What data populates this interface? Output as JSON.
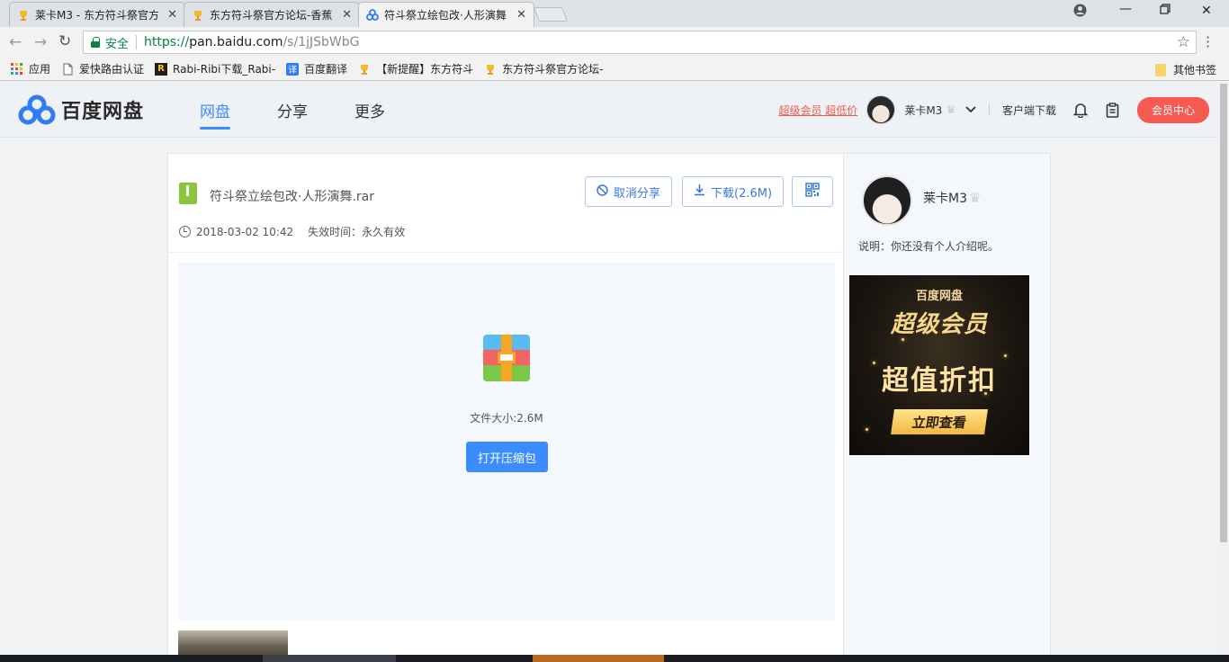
{
  "browser": {
    "tabs": [
      {
        "title": "莱卡M3 - 东方符斗祭官方",
        "active": false
      },
      {
        "title": "东方符斗祭官方论坛-香蕉",
        "active": false
      },
      {
        "title": "符斗祭立绘包改·人形演舞",
        "active": true
      }
    ],
    "address": {
      "secure_label": "安全",
      "scheme": "https://",
      "host": "pan.baidu.com",
      "path": "/s/1jJSbWbG"
    },
    "bookmarks": [
      {
        "label": "应用",
        "icon": "apps-grid-icon"
      },
      {
        "label": "爱快路由认证",
        "icon": "page-icon"
      },
      {
        "label": "Rabi-Ribi下载_Rabi-",
        "icon": "rabi-icon"
      },
      {
        "label": "百度翻译",
        "icon": "translate-icon"
      },
      {
        "label": "【新提醒】东方符斗",
        "icon": "trophy-icon"
      },
      {
        "label": "东方符斗祭官方论坛-",
        "icon": "trophy-icon"
      }
    ],
    "other_bookmarks": "其他书签"
  },
  "header": {
    "logo_text": "百度网盘",
    "nav": [
      {
        "label": "网盘",
        "active": true
      },
      {
        "label": "分享",
        "active": false
      },
      {
        "label": "更多",
        "active": false
      }
    ],
    "svip_link": "超级会员 超低价",
    "username": "莱卡M3",
    "client_download": "客户端下载",
    "vip_center": "会员中心"
  },
  "file": {
    "name": "符斗祭立绘包改·人形演舞.rar",
    "cancel_share": "取消分享",
    "download": "下载(2.6M)",
    "date": "2018-03-02 10:42",
    "expire_label": "失效时间：",
    "expire_value": "永久有效",
    "size_text": "文件大小:2.6M",
    "open_button": "打开压缩包"
  },
  "sidebar": {
    "name": "莱卡M3",
    "desc": "说明：你还没有个人介绍呢。",
    "ad": {
      "brand": "百度网盘",
      "title": "超级会员",
      "slogan": "超值折扣",
      "cta": "立即查看"
    }
  },
  "colors": {
    "accent": "#3b8cff",
    "vip_red": "#f65a51",
    "secure_green": "#0b8043"
  }
}
